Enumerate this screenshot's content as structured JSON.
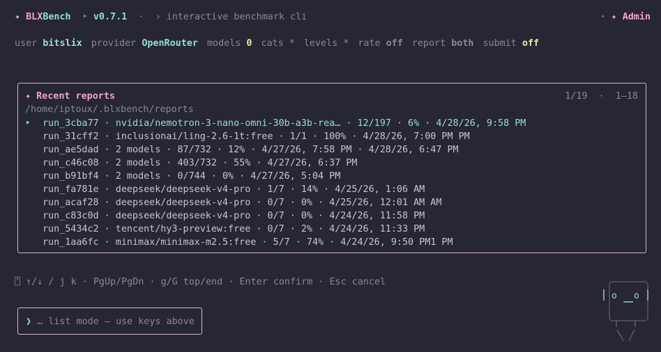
{
  "header": {
    "logo_glyph": "✦",
    "app_name_a": "BLX",
    "app_name_b": "Bench",
    "version_bullet": "‣",
    "version": "v0.7.1",
    "separator": "·",
    "tagline": "› interactive benchmark cli",
    "admin_prefix": "· ✦",
    "admin_label": "Admin"
  },
  "status_bar": {
    "items": [
      {
        "key": "user",
        "value": "bitslix"
      },
      {
        "key": "provider",
        "value": "OpenRouter"
      },
      {
        "key": "models",
        "value": "0"
      },
      {
        "key": "cats",
        "value": "*"
      },
      {
        "key": "levels",
        "value": "*"
      },
      {
        "key": "rate",
        "value": "off"
      },
      {
        "key": "report",
        "value": "both"
      },
      {
        "key": "submit",
        "value": "off"
      }
    ]
  },
  "panel": {
    "title_glyph": "✦",
    "title": "Recent reports",
    "page_position": "1/19",
    "page_separator": "·",
    "page_range": "1–18",
    "path": "/home/iptoux/.blxbench/reports",
    "selected_caret": "‣",
    "items": [
      {
        "text": "run_3cba77 · nvidia/nemotron-3-nano-omni-30b-a3b-rea… · 12/197 · 6% · 4/28/26, 9:58 PM",
        "selected": true
      },
      {
        "text": "run_31cff2 · inclusionai/ling-2.6-1t:free · 1/1 · 100% · 4/28/26, 7:00 PM PM",
        "selected": false
      },
      {
        "text": "run_ae5dad · 2 models · 87/732 · 12% · 4/27/26, 7:58 PM · 4/28/26, 6:47 PM",
        "selected": false
      },
      {
        "text": "run_c46c08 · 2 models · 403/732 · 55% · 4/27/26, 6:37 PM",
        "selected": false
      },
      {
        "text": "run_b91bf4 · 2 models · 0/744 · 0% · 4/27/26, 5:04 PM",
        "selected": false
      },
      {
        "text": "run_fa781e · deepseek/deepseek-v4-pro · 1/7 · 14% · 4/25/26, 1:06 AM",
        "selected": false
      },
      {
        "text": "run_acaf28 · deepseek/deepseek-v4-pro · 0/7 · 0% · 4/25/26, 12:01 AM AM",
        "selected": false
      },
      {
        "text": "run_c83c0d · deepseek/deepseek-v4-pro · 0/7 · 0% · 4/24/26, 11:58 PM",
        "selected": false
      },
      {
        "text": "run_5434c2 · tencent/hy3-preview:free · 0/7 · 2% · 4/24/26, 11:33 PM",
        "selected": false
      },
      {
        "text": "run_1aa6fc · minimax/minimax-m2.5:free · 5/7 · 74% · 4/24/26, 9:50 PM1 PM",
        "selected": false
      }
    ]
  },
  "key_hints": "⍞ ↑/↓ / j k · PgUp/PgDn · g/G top/end · Enter confirm · Esc cancel",
  "prompt": {
    "glyph": "❯",
    "text": "… list mode — use keys above"
  },
  "mascot": {
    "face": "o __ o",
    "icon_name": "robot-mascot-icon"
  },
  "colors": {
    "background": "#272633",
    "accent_pink": "#f0a3d2",
    "accent_teal": "#8fe1cf",
    "accent_yellow": "#f4e3a2",
    "border": "#d9b6d3"
  }
}
